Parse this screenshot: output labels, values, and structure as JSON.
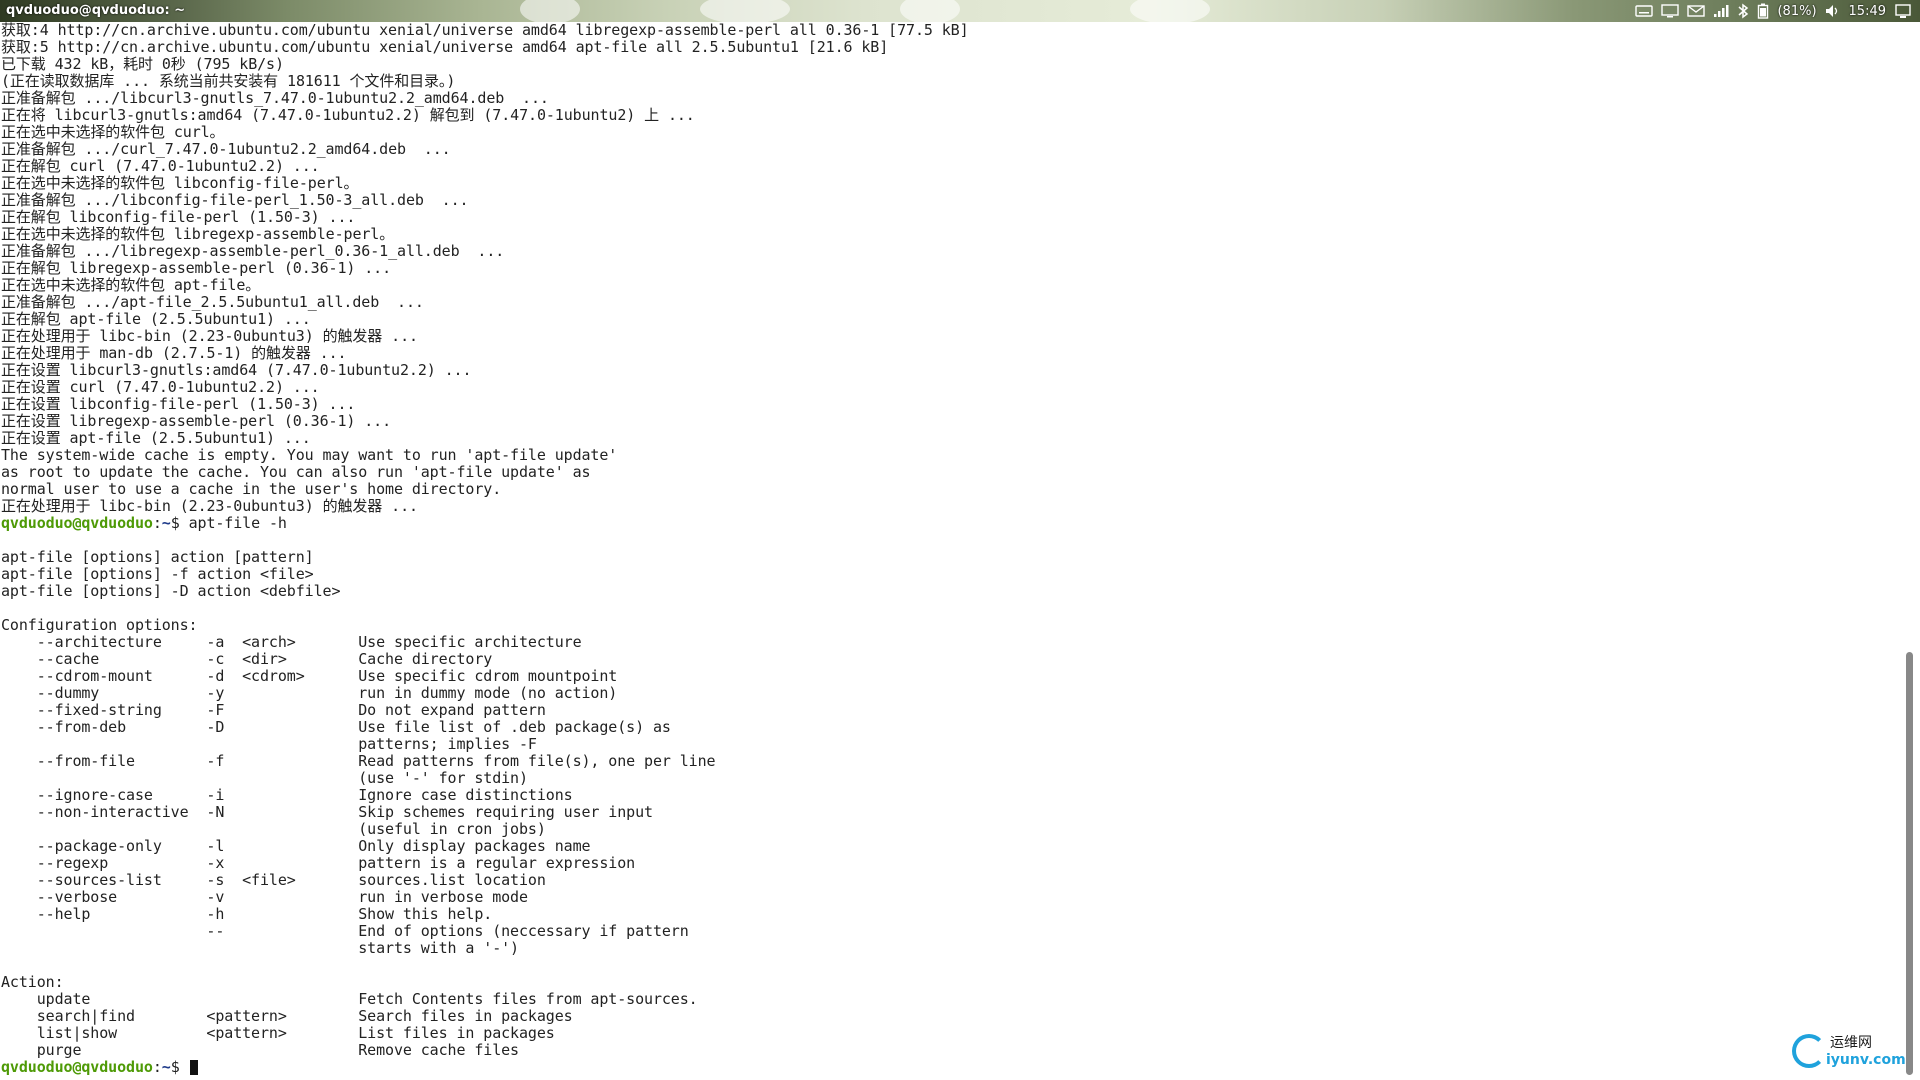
{
  "window": {
    "title": "qvduoduo@qvduoduo: ~"
  },
  "tray": {
    "icons": [
      "keyboard-icon",
      "display-icon",
      "mail-icon",
      "signal-icon",
      "bluetooth-icon",
      "battery-icon",
      "volume-icon",
      "power-icon"
    ],
    "battery_text": "(81%)",
    "clock": "15:49"
  },
  "prompt": {
    "user": "qvduoduo@qvduoduo",
    "path": "~"
  },
  "terminal": {
    "lines": [
      {
        "type": "text",
        "text": "获取:4 http://cn.archive.ubuntu.com/ubuntu xenial/universe amd64 libregexp-assemble-perl all 0.36-1 [77.5 kB]"
      },
      {
        "type": "text",
        "text": "获取:5 http://cn.archive.ubuntu.com/ubuntu xenial/universe amd64 apt-file all 2.5.5ubuntu1 [21.6 kB]"
      },
      {
        "type": "text",
        "text": "已下载 432 kB，耗时 0秒 (795 kB/s)"
      },
      {
        "type": "text",
        "text": "(正在读取数据库 ... 系统当前共安装有 181611 个文件和目录。)"
      },
      {
        "type": "text",
        "text": "正准备解包 .../libcurl3-gnutls_7.47.0-1ubuntu2.2_amd64.deb  ..."
      },
      {
        "type": "text",
        "text": "正在将 libcurl3-gnutls:amd64 (7.47.0-1ubuntu2.2) 解包到 (7.47.0-1ubuntu2) 上 ..."
      },
      {
        "type": "text",
        "text": "正在选中未选择的软件包 curl。"
      },
      {
        "type": "text",
        "text": "正准备解包 .../curl_7.47.0-1ubuntu2.2_amd64.deb  ..."
      },
      {
        "type": "text",
        "text": "正在解包 curl (7.47.0-1ubuntu2.2) ..."
      },
      {
        "type": "text",
        "text": "正在选中未选择的软件包 libconfig-file-perl。"
      },
      {
        "type": "text",
        "text": "正准备解包 .../libconfig-file-perl_1.50-3_all.deb  ..."
      },
      {
        "type": "text",
        "text": "正在解包 libconfig-file-perl (1.50-3) ..."
      },
      {
        "type": "text",
        "text": "正在选中未选择的软件包 libregexp-assemble-perl。"
      },
      {
        "type": "text",
        "text": "正准备解包 .../libregexp-assemble-perl_0.36-1_all.deb  ..."
      },
      {
        "type": "text",
        "text": "正在解包 libregexp-assemble-perl (0.36-1) ..."
      },
      {
        "type": "text",
        "text": "正在选中未选择的软件包 apt-file。"
      },
      {
        "type": "text",
        "text": "正准备解包 .../apt-file_2.5.5ubuntu1_all.deb  ..."
      },
      {
        "type": "text",
        "text": "正在解包 apt-file (2.5.5ubuntu1) ..."
      },
      {
        "type": "text",
        "text": "正在处理用于 libc-bin (2.23-0ubuntu3) 的触发器 ..."
      },
      {
        "type": "text",
        "text": "正在处理用于 man-db (2.7.5-1) 的触发器 ..."
      },
      {
        "type": "text",
        "text": "正在设置 libcurl3-gnutls:amd64 (7.47.0-1ubuntu2.2) ..."
      },
      {
        "type": "text",
        "text": "正在设置 curl (7.47.0-1ubuntu2.2) ..."
      },
      {
        "type": "text",
        "text": "正在设置 libconfig-file-perl (1.50-3) ..."
      },
      {
        "type": "text",
        "text": "正在设置 libregexp-assemble-perl (0.36-1) ..."
      },
      {
        "type": "text",
        "text": "正在设置 apt-file (2.5.5ubuntu1) ..."
      },
      {
        "type": "text",
        "text": "The system-wide cache is empty. You may want to run 'apt-file update'"
      },
      {
        "type": "text",
        "text": "as root to update the cache. You can also run 'apt-file update' as"
      },
      {
        "type": "text",
        "text": "normal user to use a cache in the user's home directory."
      },
      {
        "type": "text",
        "text": "正在处理用于 libc-bin (2.23-0ubuntu3) 的触发器 ..."
      },
      {
        "type": "prompt",
        "command": "apt-file -h"
      },
      {
        "type": "text",
        "text": ""
      },
      {
        "type": "text",
        "text": "apt-file [options] action [pattern]"
      },
      {
        "type": "text",
        "text": "apt-file [options] -f action <file>"
      },
      {
        "type": "text",
        "text": "apt-file [options] -D action <debfile>"
      },
      {
        "type": "text",
        "text": ""
      },
      {
        "type": "text",
        "text": "Configuration options:"
      },
      {
        "type": "text",
        "text": "    --architecture     -a  <arch>       Use specific architecture"
      },
      {
        "type": "text",
        "text": "    --cache            -c  <dir>        Cache directory"
      },
      {
        "type": "text",
        "text": "    --cdrom-mount      -d  <cdrom>      Use specific cdrom mountpoint"
      },
      {
        "type": "text",
        "text": "    --dummy            -y               run in dummy mode (no action)"
      },
      {
        "type": "text",
        "text": "    --fixed-string     -F               Do not expand pattern"
      },
      {
        "type": "text",
        "text": "    --from-deb         -D               Use file list of .deb package(s) as"
      },
      {
        "type": "text",
        "text": "                                        patterns; implies -F"
      },
      {
        "type": "text",
        "text": "    --from-file        -f               Read patterns from file(s), one per line"
      },
      {
        "type": "text",
        "text": "                                        (use '-' for stdin)"
      },
      {
        "type": "text",
        "text": "    --ignore-case      -i               Ignore case distinctions"
      },
      {
        "type": "text",
        "text": "    --non-interactive  -N               Skip schemes requiring user input"
      },
      {
        "type": "text",
        "text": "                                        (useful in cron jobs)"
      },
      {
        "type": "text",
        "text": "    --package-only     -l               Only display packages name"
      },
      {
        "type": "text",
        "text": "    --regexp           -x               pattern is a regular expression"
      },
      {
        "type": "text",
        "text": "    --sources-list     -s  <file>       sources.list location"
      },
      {
        "type": "text",
        "text": "    --verbose          -v               run in verbose mode"
      },
      {
        "type": "text",
        "text": "    --help             -h               Show this help."
      },
      {
        "type": "text",
        "text": "                       --               End of options (neccessary if pattern"
      },
      {
        "type": "text",
        "text": "                                        starts with a '-')"
      },
      {
        "type": "text",
        "text": ""
      },
      {
        "type": "text",
        "text": "Action:"
      },
      {
        "type": "text",
        "text": "    update                              Fetch Contents files from apt-sources."
      },
      {
        "type": "text",
        "text": "    search|find        <pattern>        Search files in packages"
      },
      {
        "type": "text",
        "text": "    list|show          <pattern>        List files in packages"
      },
      {
        "type": "text",
        "text": "    purge                               Remove cache files"
      },
      {
        "type": "prompt",
        "command": "",
        "cursor": true
      }
    ]
  },
  "scrollbar": {
    "position_fraction": 0.6,
    "visible_fraction": 0.4
  },
  "watermark": {
    "top": "运维网",
    "bottom": "iyunv.com"
  }
}
